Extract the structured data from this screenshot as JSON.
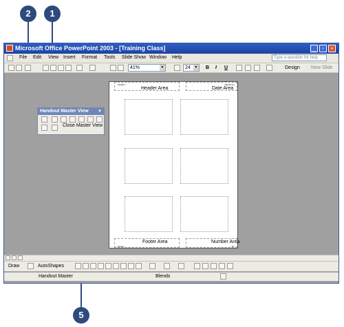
{
  "callouts": {
    "c1": "1",
    "c2": "2",
    "c5": "5"
  },
  "window": {
    "title": "Microsoft Office PowerPoint 2003 - [Training Class]",
    "controls": {
      "minimize": "_",
      "maximize": "▫",
      "close": "×"
    }
  },
  "menu": {
    "items": [
      "File",
      "Edit",
      "View",
      "Insert",
      "Format",
      "Tools",
      "Slide Show",
      "Window",
      "Help"
    ],
    "help_placeholder": "Type a question for help"
  },
  "toolbar": {
    "zoom": "41%",
    "font_size": "24",
    "bold": "B",
    "italic": "I",
    "underline": "U",
    "design": "Design",
    "new_slide": "New Slide"
  },
  "slide": {
    "header_area": "Header Area",
    "date_area": "Date Area",
    "footer_area": "Footer Area",
    "number_area": "Number Area",
    "header_tiny": "<header>",
    "date_tiny": "<date/time>",
    "footer_tiny": "<footer>",
    "number_tiny": "<#>"
  },
  "handout_toolbar": {
    "title": "Handout Master View",
    "close_label": "Close Master View"
  },
  "drawbar": {
    "draw": "Draw",
    "autoshapes": "AutoShapes"
  },
  "status": {
    "left": "Handout Master",
    "mid": "Blends"
  },
  "colors": {
    "callout": "#2e4a7d",
    "titlebar": "#2354b8",
    "workspace": "#a0a0a0"
  }
}
